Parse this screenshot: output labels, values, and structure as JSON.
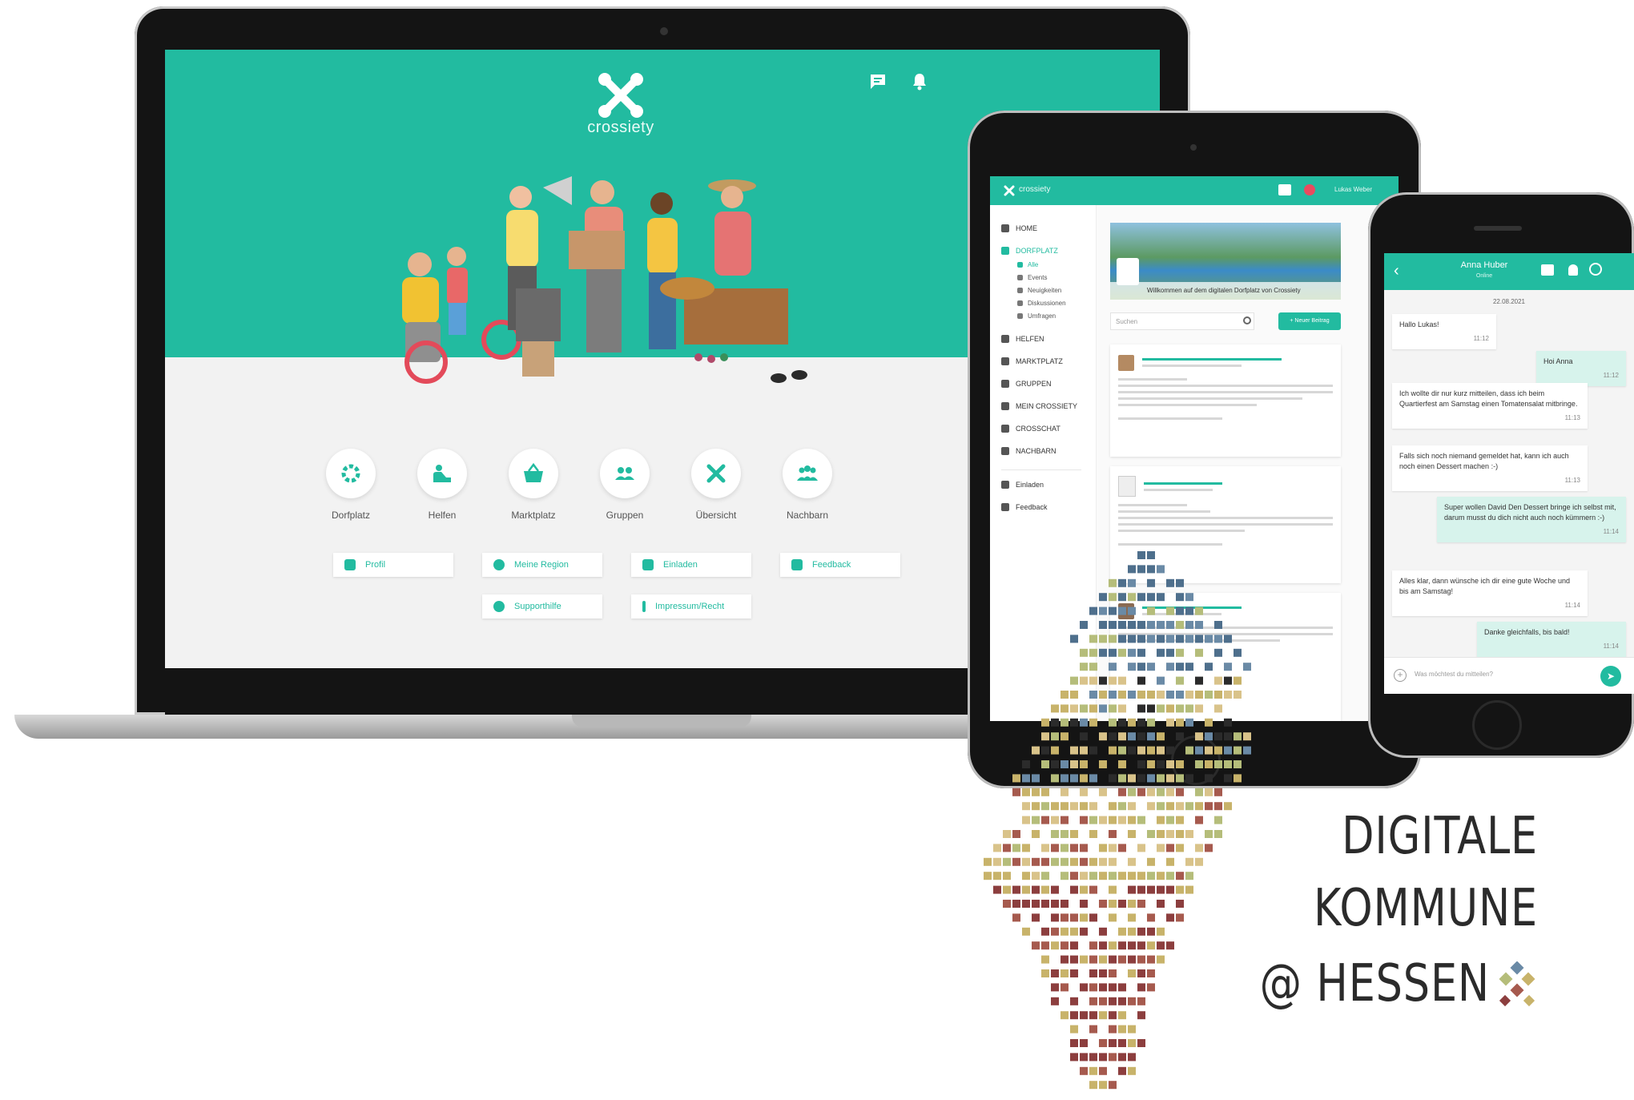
{
  "laptop": {
    "brand": "crossiety",
    "tiles": [
      {
        "label": "Dorfplatz",
        "icon": "gear-icon"
      },
      {
        "label": "Helfen",
        "icon": "helping-hand-icon"
      },
      {
        "label": "Marktplatz",
        "icon": "basket-icon"
      },
      {
        "label": "Gruppen",
        "icon": "group-icon"
      },
      {
        "label": "Übersicht",
        "icon": "crossiety-icon"
      },
      {
        "label": "Nachbarn",
        "icon": "neighbors-icon"
      }
    ],
    "buttons": [
      "Profil",
      "Meine Region",
      "Einladen",
      "Feedback",
      "Supporthilfe",
      "Impressum/Recht"
    ]
  },
  "tablet": {
    "brand": "crossiety",
    "user": "Lukas Weber",
    "nav": [
      "HOME",
      "DORFPLATZ",
      "HELFEN",
      "MARKTPLATZ",
      "GRUPPEN",
      "MEIN CROSSIETY",
      "CROSSCHAT",
      "NACHBARN"
    ],
    "subnav": [
      "Alle",
      "Events",
      "Neuigkeiten",
      "Diskussionen",
      "Umfragen"
    ],
    "nav_bottom": [
      "Einladen",
      "Feedback"
    ],
    "banner_caption": "Willkommen auf dem digitalen Dorfplatz von Crossiety",
    "search_placeholder": "Suchen",
    "new_post": "+ Neuer Beitrag"
  },
  "phone": {
    "contact_name": "Anna Huber",
    "contact_status": "Online",
    "date": "22.08.2021",
    "messages": [
      {
        "dir": "in",
        "text": "Hallo Lukas!",
        "time": "11:12"
      },
      {
        "dir": "out",
        "text": "Hoi Anna",
        "time": "11:12"
      },
      {
        "dir": "in",
        "text": "Ich wollte dir nur kurz mitteilen, dass ich beim Quartierfest am Samstag einen Tomatensalat mitbringe.",
        "time": "11:13"
      },
      {
        "dir": "in",
        "text": "Falls sich noch niemand gemeldet hat, kann ich auch noch einen Dessert machen :-)",
        "time": "11:13"
      },
      {
        "dir": "out",
        "text": "Super wollen David Den Dessert bringe ich selbst mit, darum musst du dich nicht auch noch kümmern :-)",
        "time": "11:14"
      },
      {
        "dir": "in",
        "text": "Alles klar, dann wünsche ich dir eine gute Woche und bis am Samstag!",
        "time": "11:14"
      },
      {
        "dir": "out",
        "text": "Danke gleichfalls, bis bald!",
        "time": "11:14"
      }
    ],
    "input_placeholder": "Was möchtest du mitteilen?"
  },
  "logo": {
    "line1": "DIGITALE",
    "line2": "KOMMUNE",
    "line3": "@ HESSEN"
  },
  "colors": {
    "accent": "#22bba0",
    "mosaic": [
      "#4e6f8c",
      "#6a8aa6",
      "#b5bd7a",
      "#c8b36a",
      "#8c3e3e",
      "#a65a4e",
      "#2b2b2b",
      "#d9c38a"
    ]
  }
}
